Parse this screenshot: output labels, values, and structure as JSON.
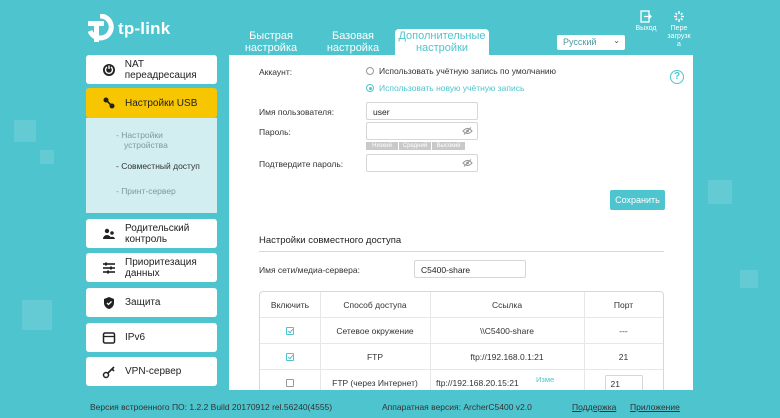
{
  "brand": {
    "name": "tp-link",
    "accent": "#4ec4ce",
    "active": "#f7c600"
  },
  "header": {
    "tabs": [
      {
        "line1": "Быстрая",
        "line2": "настройка"
      },
      {
        "line1": "Базовая",
        "line2": "настройка"
      },
      {
        "line1": "Дополнительные",
        "line2": "настройки"
      }
    ],
    "language": "Русский",
    "exit_label": "Выход",
    "reboot_label_1": "Пере",
    "reboot_label_2": "загрузк",
    "reboot_label_3": "а"
  },
  "sidebar": {
    "items": [
      {
        "label": "NAT переадресация",
        "icon": "nat-icon"
      },
      {
        "label": "Настройки USB",
        "icon": "usb-icon"
      },
      {
        "line1": "Родительский",
        "line2": "контроль",
        "icon": "parental-icon"
      },
      {
        "line1": "Приоритезация",
        "line2": "данных",
        "icon": "qos-icon"
      },
      {
        "label": "Защита",
        "icon": "shield-icon"
      },
      {
        "label": "IPv6",
        "icon": "ipv6-icon"
      },
      {
        "label": "VPN-сервер",
        "icon": "vpn-icon"
      }
    ],
    "sub": [
      {
        "line1": "- Настройки",
        "line2": "устройства"
      },
      {
        "label": "- Совместный доступ"
      },
      {
        "label": "- Принт-сервер"
      }
    ]
  },
  "account": {
    "label": "Аккаунт:",
    "opt_default": "Использовать учётную запись по умолчанию",
    "opt_new": "Использовать новую учётную запись",
    "username_label": "Имя пользователя:",
    "username_value": "user",
    "password_label": "Пароль:",
    "confirm_label": "Подтвердите пароль:",
    "strength": [
      "Низкий",
      "Средний",
      "Высокий"
    ],
    "save_label": "Сохранить"
  },
  "sharing": {
    "title": "Настройки совместного доступа",
    "server_label": "Имя сети/медиа-сервера:",
    "server_value": "C5400-share",
    "table": {
      "headers": [
        "Включить",
        "Способ доступа",
        "Ссылка",
        "Порт"
      ],
      "rows": [
        {
          "checked": true,
          "method": "Сетевое окружение",
          "link": "\\\\C5400-share",
          "port": "---"
        },
        {
          "checked": true,
          "method": "FTP",
          "link": "ftp://192.168.0.1:21",
          "port": "21"
        },
        {
          "checked": false,
          "method": "FTP (через Интернет)",
          "link": "ftp://192.168.20.15:21",
          "edit": "Изме",
          "port": "21"
        }
      ]
    }
  },
  "footer": {
    "firmware": "Версия встроенного ПО: 1.2.2 Build 20170912 rel.56240(4555)",
    "hardware": "Аппаратная версия: ArcherC5400 v2.0",
    "support": "Поддержка",
    "app": "Приложение"
  }
}
